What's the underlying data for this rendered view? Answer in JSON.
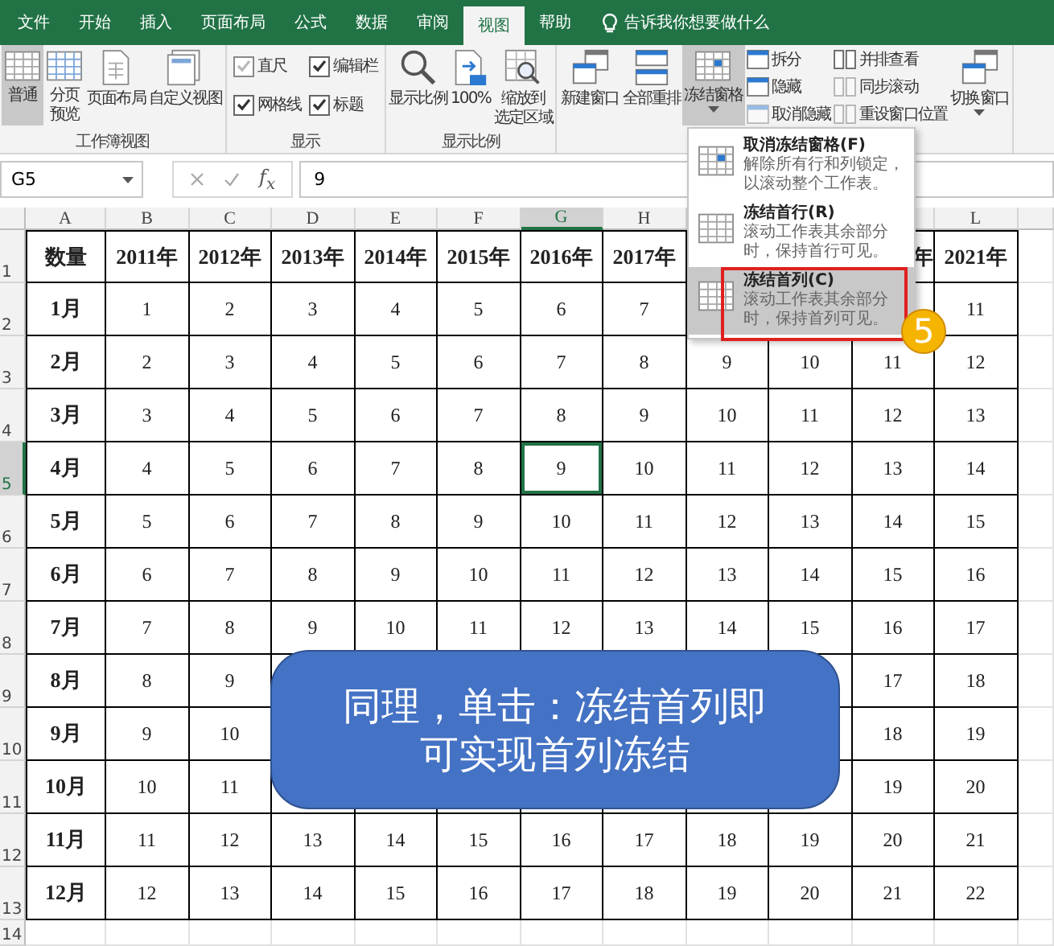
{
  "tabs": [
    {
      "label": "文件",
      "selected": false
    },
    {
      "label": "开始",
      "selected": false
    },
    {
      "label": "插入",
      "selected": false
    },
    {
      "label": "页面布局",
      "selected": false
    },
    {
      "label": "公式",
      "selected": false
    },
    {
      "label": "数据",
      "selected": false
    },
    {
      "label": "审阅",
      "selected": false
    },
    {
      "label": "视图",
      "selected": true
    },
    {
      "label": "帮助",
      "selected": false
    }
  ],
  "tell_me": "告诉我你想要做什么",
  "ribbon": {
    "groups": [
      {
        "label": "工作簿视图",
        "items": [
          {
            "kind": "large",
            "label": "普通",
            "pressed": true,
            "disabled": false
          },
          {
            "kind": "large",
            "label": "分页预览",
            "pressed": false,
            "disabled": false
          },
          {
            "kind": "large",
            "label": "页面布局",
            "pressed": false,
            "disabled": false
          },
          {
            "kind": "large",
            "label": "自定义视图",
            "pressed": false,
            "disabled": false
          }
        ]
      },
      {
        "label": "显示",
        "items": [
          {
            "kind": "check",
            "label": "直尺",
            "checked": true,
            "disabled": true
          },
          {
            "kind": "check",
            "label": "编辑栏",
            "checked": true,
            "disabled": false
          },
          {
            "kind": "check",
            "label": "网格线",
            "checked": true,
            "disabled": false
          },
          {
            "kind": "check",
            "label": "标题",
            "checked": true,
            "disabled": false
          }
        ]
      },
      {
        "label": "显示比例",
        "items": [
          {
            "kind": "large",
            "label": "显示比例",
            "pressed": false,
            "disabled": false
          },
          {
            "kind": "large",
            "label": "100%",
            "pressed": false,
            "disabled": false
          },
          {
            "kind": "large",
            "label": "缩放到选定区域",
            "pressed": false,
            "disabled": false
          }
        ]
      },
      {
        "items": [
          {
            "kind": "large",
            "label": "新建窗口",
            "pressed": false,
            "disabled": false
          },
          {
            "kind": "large",
            "label": "全部重排",
            "pressed": false,
            "disabled": false
          },
          {
            "kind": "large",
            "label": "冻结窗格",
            "pressed": true,
            "disabled": false,
            "dropdown": true
          },
          {
            "kind": "small",
            "label": "拆分",
            "disabled": false
          },
          {
            "kind": "small",
            "label": "隐藏",
            "disabled": false
          },
          {
            "kind": "small",
            "label": "取消隐藏",
            "disabled": true
          },
          {
            "kind": "small",
            "label": "并排查看",
            "disabled": false
          },
          {
            "kind": "small",
            "label": "同步滚动",
            "disabled": true
          },
          {
            "kind": "small",
            "label": "重设窗口位置",
            "disabled": true
          },
          {
            "kind": "large",
            "label": "切换窗口",
            "pressed": false,
            "disabled": false,
            "dropdown": true
          }
        ]
      }
    ]
  },
  "formula_bar": {
    "name_box": "G5",
    "function_label": "f$_{x}$",
    "value": "9"
  },
  "sheet": {
    "columns": [
      {
        "label": "A",
        "selected": false
      },
      {
        "label": "B",
        "selected": false
      },
      {
        "label": "C",
        "selected": false
      },
      {
        "label": "D",
        "selected": false
      },
      {
        "label": "E",
        "selected": false
      },
      {
        "label": "F",
        "selected": false
      },
      {
        "label": "G",
        "selected": true
      },
      {
        "label": "H",
        "selected": false
      },
      null,
      null,
      null,
      {
        "label": "L",
        "selected": false
      }
    ],
    "rows": [
      {
        "header": "1",
        "selected": false,
        "cells": [
          "数量",
          "2011年",
          "2012年",
          "2013年",
          "2014年",
          "2015年",
          "2016年",
          "2017年",
          null,
          null,
          {
            "text": "年",
            "clipped": true
          },
          "2021年"
        ]
      },
      {
        "header": "2",
        "selected": false,
        "cells": [
          "1月",
          "1",
          "2",
          "3",
          "4",
          "5",
          "6",
          "7",
          null,
          null,
          null,
          "11"
        ]
      },
      {
        "header": "3",
        "selected": false,
        "cells": [
          "2月",
          "2",
          "3",
          "4",
          "5",
          "6",
          "7",
          "8",
          "9",
          "10",
          "11",
          "12"
        ]
      },
      {
        "header": "4",
        "selected": false,
        "cells": [
          "3月",
          "3",
          "4",
          "5",
          "6",
          "7",
          "8",
          "9",
          "10",
          "11",
          "12",
          "13"
        ]
      },
      {
        "header": "5",
        "selected": true,
        "cells": [
          "4月",
          "4",
          "5",
          "6",
          "7",
          "8",
          "9",
          "10",
          "11",
          "12",
          "13",
          "14"
        ]
      },
      {
        "header": "6",
        "selected": false,
        "cells": [
          "5月",
          "5",
          "6",
          "7",
          "8",
          "9",
          "10",
          "11",
          "12",
          "13",
          "14",
          "15"
        ]
      },
      {
        "header": "7",
        "selected": false,
        "cells": [
          "6月",
          "6",
          "7",
          "8",
          "9",
          "10",
          "11",
          "12",
          "13",
          "14",
          "15",
          "16"
        ]
      },
      {
        "header": "8",
        "selected": false,
        "cells": [
          "7月",
          "7",
          "8",
          "9",
          "10",
          "11",
          "12",
          "13",
          "14",
          "15",
          "16",
          "17"
        ]
      },
      {
        "header": "9",
        "selected": false,
        "cells": [
          "8月",
          "8",
          "9",
          null,
          null,
          null,
          null,
          null,
          null,
          null,
          "17",
          "18"
        ]
      },
      {
        "header": "10",
        "selected": false,
        "cells": [
          "9月",
          "9",
          "10",
          null,
          null,
          null,
          null,
          null,
          null,
          null,
          "18",
          "19"
        ]
      },
      {
        "header": "11",
        "selected": false,
        "cells": [
          "10月",
          "10",
          "11",
          null,
          null,
          null,
          null,
          null,
          null,
          null,
          "19",
          "20"
        ]
      },
      {
        "header": "12",
        "selected": false,
        "cells": [
          "11月",
          "11",
          "12",
          "13",
          "14",
          "15",
          "16",
          "17",
          "18",
          "19",
          "20",
          "21"
        ]
      },
      {
        "header": "13",
        "selected": false,
        "cells": [
          "12月",
          "12",
          "13",
          "14",
          "15",
          "16",
          "17",
          "18",
          "19",
          "20",
          "21",
          "22"
        ]
      },
      {
        "header": "14",
        "selected": false
      }
    ]
  },
  "freeze_menu": {
    "items": [
      {
        "title": "取消冻结窗格(F)",
        "description": "解除所有行和列锁定，以滚动整个工作表。",
        "selected": false,
        "highlighted": false
      },
      {
        "title": "冻结首行(R)",
        "description": "滚动工作表其余部分时，保持首行可见。",
        "selected": false,
        "highlighted": false
      },
      {
        "title": "冻结首列(C)",
        "description": "滚动工作表其余部分时，保持首列可见。",
        "selected": true,
        "highlighted": true
      }
    ],
    "step_badge": "5"
  },
  "callout": "同理，单击：冻结首列即可实现首列冻结"
}
